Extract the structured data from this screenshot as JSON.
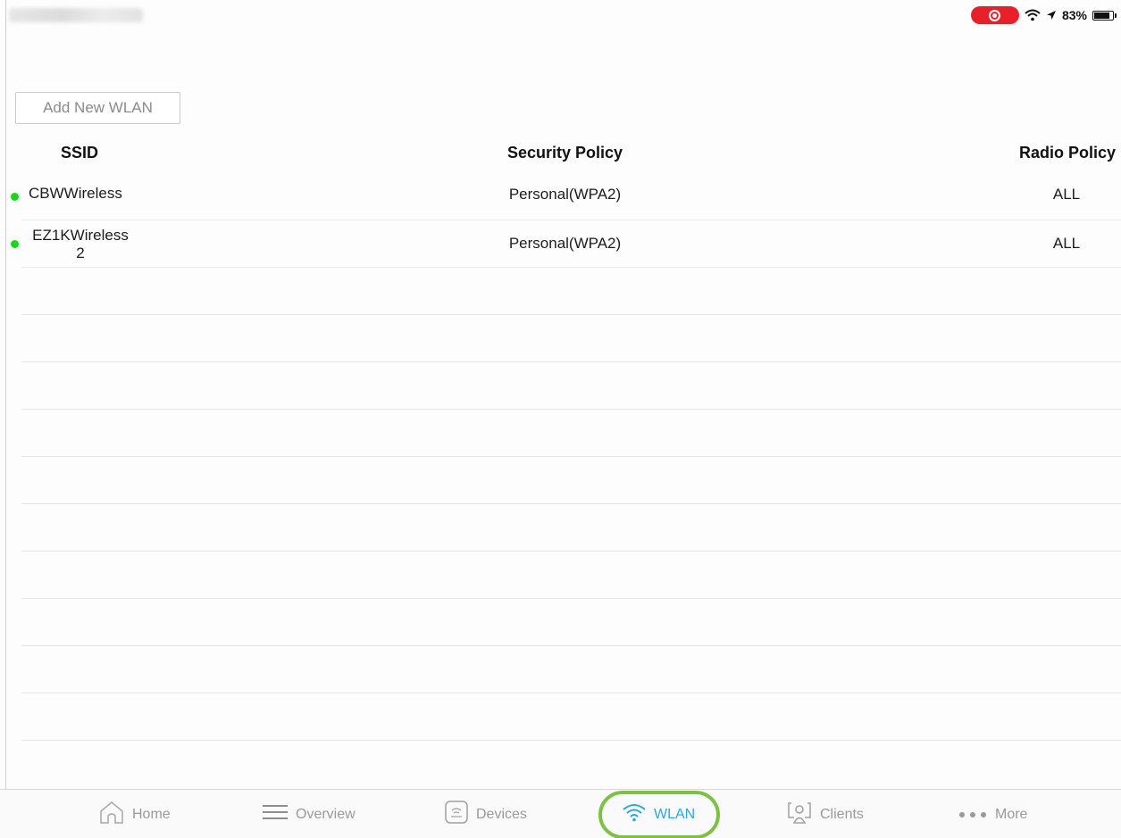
{
  "status_bar": {
    "battery_percent": "83%",
    "battery_level": 0.83,
    "icons": [
      "record-icon",
      "wifi-icon",
      "location-icon",
      "battery-icon"
    ],
    "record_color": "#e8202a"
  },
  "toolbar": {
    "add_label": "Add New WLAN"
  },
  "table": {
    "headers": {
      "ssid": "SSID",
      "security": "Security Policy",
      "radio": "Radio Policy"
    },
    "rows": [
      {
        "ssid": "CBWWireless",
        "ssid_line2": "",
        "security": "Personal(WPA2)",
        "radio": "ALL",
        "status_color": "#16d916"
      },
      {
        "ssid": "EZ1KWireless",
        "ssid_line2": "2",
        "security": "Personal(WPA2)",
        "radio": "ALL",
        "status_color": "#16d916"
      }
    ]
  },
  "tabs": [
    {
      "label": "Home",
      "icon": "home-icon"
    },
    {
      "label": "Overview",
      "icon": "list-icon"
    },
    {
      "label": "Devices",
      "icon": "device-icon"
    },
    {
      "label": "WLAN",
      "icon": "wifi-icon",
      "selected": true
    },
    {
      "label": "Clients",
      "icon": "clients-icon"
    },
    {
      "label": "More",
      "icon": "more-icon"
    }
  ],
  "colors": {
    "accent": "#2aa8e0",
    "highlight": "#7cc242",
    "status_active": "#16d916"
  }
}
